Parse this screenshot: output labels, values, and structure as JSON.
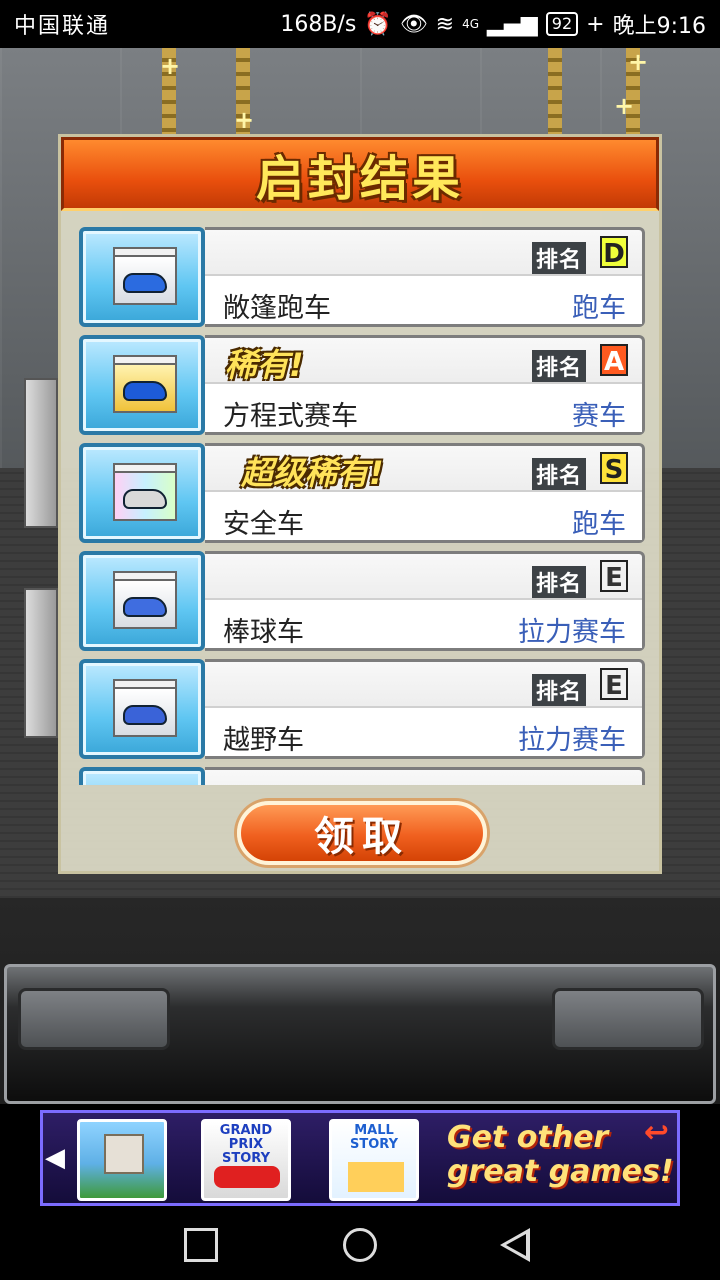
{
  "status_bar": {
    "carrier": "中国联通",
    "net_speed": "168B/s",
    "signal_label": "4G",
    "battery": "92",
    "time": "晚上9:16"
  },
  "modal": {
    "title": "启封结果",
    "claim_label": "领取",
    "items": [
      {
        "name": "敞篷跑车",
        "type": "跑车",
        "rank_label": "排名",
        "rank": "D",
        "rarity": "",
        "car_color": "#2b6be0"
      },
      {
        "name": "方程式赛车",
        "type": "赛车",
        "rank_label": "排名",
        "rank": "A",
        "rarity": "稀有!",
        "car_color": "#1d5bd8"
      },
      {
        "name": "安全车",
        "type": "跑车",
        "rank_label": "排名",
        "rank": "S",
        "rarity": "超级稀有!",
        "car_color": "#d9d9d9"
      },
      {
        "name": "棒球车",
        "type": "拉力赛车",
        "rank_label": "排名",
        "rank": "E",
        "rarity": "",
        "car_color": "#3f6de0"
      },
      {
        "name": "越野车",
        "type": "拉力赛车",
        "rank_label": "排名",
        "rank": "E",
        "rarity": "",
        "car_color": "#3a63d8"
      }
    ]
  },
  "ad_banner": {
    "tiles": [
      "",
      "GRAND PRIX STORY",
      "MALL STORY"
    ],
    "cta": "Get other great games!"
  },
  "nav": {
    "back_icon": "square-icon",
    "home_icon": "circle-icon",
    "recent_icon": "triangle-back-icon"
  }
}
